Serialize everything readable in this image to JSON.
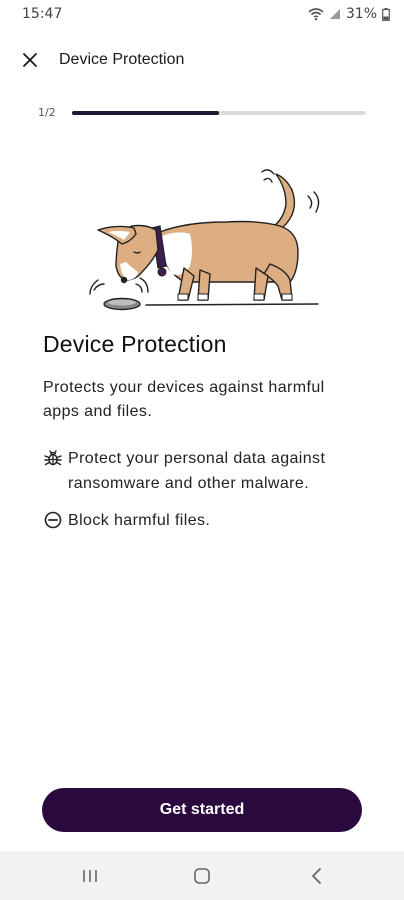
{
  "status": {
    "time": "15:47",
    "battery": "31%"
  },
  "header": {
    "title": "Device Protection",
    "close_icon": "close-icon"
  },
  "progress": {
    "label": "1/2",
    "fraction": 0.5
  },
  "content": {
    "heading": "Device Protection",
    "description": "Protects your devices against harmful apps and files.",
    "features": [
      {
        "icon": "bug-icon",
        "text": "Protect your personal data against ransomware and other malware."
      },
      {
        "icon": "block-icon",
        "text": "Block harmful files."
      }
    ]
  },
  "cta": {
    "label": "Get started"
  },
  "colors": {
    "primary": "#2a0a3e",
    "progress": "#1c1a2e",
    "dog_fur": "#dcae82",
    "collar": "#3b1e52"
  }
}
